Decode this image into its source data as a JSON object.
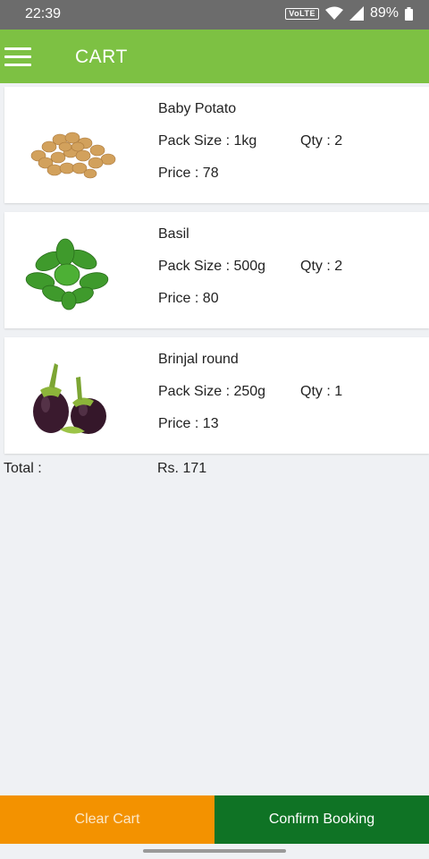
{
  "status_bar": {
    "time": "22:39",
    "network_badge": "VoLTE",
    "battery": "89%"
  },
  "app_bar": {
    "title": "CART",
    "menu_icon": "hamburger-menu-icon"
  },
  "cart_items": [
    {
      "name": "Baby Potato",
      "pack_size": "Pack Size : 1kg",
      "qty": "Qty : 2",
      "price": "Price : 78",
      "image_icon": "potato-image"
    },
    {
      "name": "Basil",
      "pack_size": "Pack Size : 500g",
      "qty": "Qty : 2",
      "price": "Price : 80",
      "image_icon": "basil-image"
    },
    {
      "name": "Brinjal round",
      "pack_size": "Pack Size : 250g",
      "qty": "Qty : 1",
      "price": "Price : 13",
      "image_icon": "brinjal-image"
    }
  ],
  "total": {
    "label": "Total :",
    "value": "Rs. 171"
  },
  "actions": {
    "clear_label": "Clear Cart",
    "confirm_label": "Confirm Booking"
  },
  "colors": {
    "app_bar": "#7dc143",
    "clear_button": "#f39200",
    "confirm_button": "#0f7325",
    "background": "#eff1f4"
  }
}
